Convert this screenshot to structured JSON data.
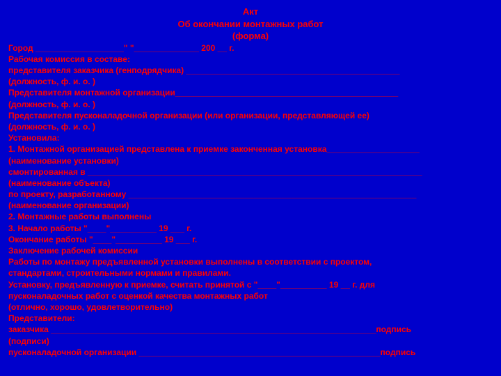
{
  "header": {
    "line1": "Акт",
    "line2": "Об окончании монтажных работ",
    "line3": "(форма)"
  },
  "body": {
    "l1": "Город ___________________\"                                                                                   \"______________ 200 __ г.",
    "l2": "Рабочая комиссия в составе:",
    "l3": "представителя заказчика (генподрядчика) ______________________________________________",
    "l4": "(должность, ф. и. о. )",
    "l5": "Представителя монтажной организации________________________________________________",
    "l6": "(должность, ф. и. о. )",
    "l7": "Представителя пусконаладочной организации (или организации, представляющей ее)",
    "l8": "(должность, ф. и. о. )",
    "l9": "Установила:",
    "l10": "1. Монтажной организацией представлена к приемке законченная установка____________________",
    "l11": "                                                                                                                       (наименование установки)",
    "l12": "смонтированная в ________________________________________________________________________",
    "l13": "                                                                     (наименование объекта)",
    "l14": "по проекту, разработанному ______________________________________________________________",
    "l15": "                                                                     (наименование организации)",
    "l16": "2. Монтажные работы выполнены",
    "l17": "3. Начало работы \"____\"__________ 19 ___ г.",
    "l18": "Окончание работы \"____\"__________ 19 ___ г.",
    "l19": "Заключение рабочей комиссии",
    "l20": "Работы по монтажу предъявленной установки выполнены в соответствии с проектом,",
    "l21": "стандартами, строительными нормами и правилами.",
    "l22": "Установку, предъявленную к приемке, считать принятой с \"____\"__________ 19 __ г. для",
    "l23": "пусконаладочных работ с оценкой качества монтажных работ",
    "l24": "(отлично, хорошо, удовлетворительно)",
    "l25": "Представители:",
    "l26": "заказчика ______________________________________________________________________подпись",
    "l27": "(подписи)",
    "l28": "пусконаладочной организации ____________________________________________________подпись"
  }
}
